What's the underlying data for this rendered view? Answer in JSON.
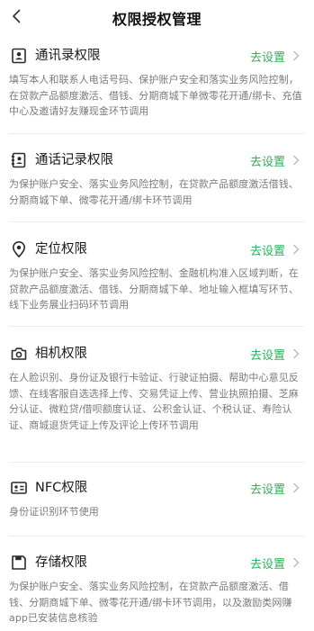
{
  "header": {
    "title": "权限授权管理"
  },
  "colors": {
    "accent_green": "#2bb25a",
    "desc_gray": "#7a7a7a"
  },
  "permissions": [
    {
      "icon": "contacts-book-icon",
      "title": "通讯录权限",
      "action": "去设置",
      "desc": "填写本人和联系人电话号码、保护账户安全和落实业务风险控制，在贷款产品额度激活、借钱、分期商城下单微零花开通/绑卡、充值中心及邀请好友赚现金环节调用"
    },
    {
      "icon": "call-log-icon",
      "title": "通话记录权限",
      "action": "去设置",
      "desc": "为保护账户安全、落实业务风险控制，在贷款产品额度激活借钱、分期商城下单、微零花开通/绑卡环节调用"
    },
    {
      "icon": "location-pin-icon",
      "title": "定位权限",
      "action": "去设置",
      "desc": "为保护账户安全、落实业务风险控制、金融机构准入区域判断，在贷款产品额度激活、借钱、分期商城下单、地址输入框填写环节、线下业务展业扫码环节调用"
    },
    {
      "icon": "camera-icon",
      "title": "相机权限",
      "action": "去设置",
      "desc": "在人脸识别、身份证及银行卡验证、行驶证拍摄、帮助中心意见反馈、在线客服自选选择上传、交易凭证上传、营业执照拍摄、芝麻分认证、微粒贷/借呗额度认证、公积金认证、个税认证、寿险认证、商城退货凭证上传及评论上传环节调用"
    },
    {
      "icon": "id-card-icon",
      "title": "NFC权限",
      "action": "去设置",
      "desc": "身份证识别环节使用"
    },
    {
      "icon": "storage-save-icon",
      "title": "存储权限",
      "action": "去设置",
      "desc": "为保护账户安全、落实业务风险控制，在贷款产品额度激活、借钱、分期商城下单、微零花开通/绑卡环节调用，以及激励类网赚app已安装信息核验"
    }
  ]
}
